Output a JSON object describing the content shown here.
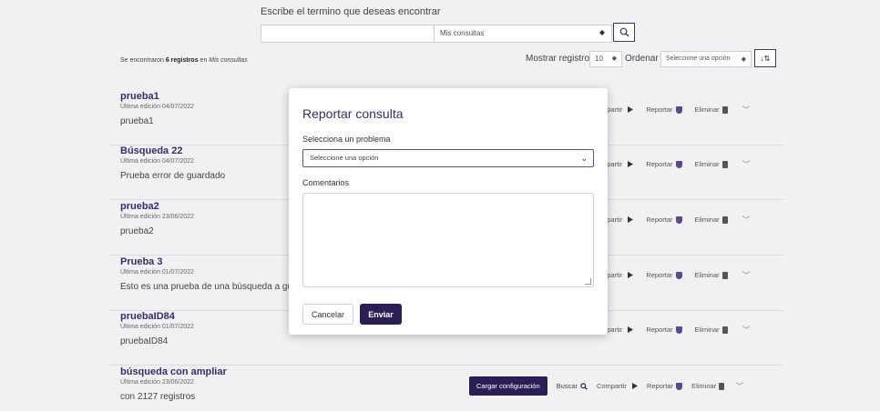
{
  "search": {
    "hint": "Escribe el termino que deseas encontrar",
    "input_value": "",
    "select_value": "Mis consultas"
  },
  "summary": {
    "prefix": "Se encontraron ",
    "count": "6 registros",
    "middle": " en ",
    "scope": "Mis consultas"
  },
  "controls": {
    "records_label": "Mostrar registros",
    "records_value": "10",
    "order_label": "Ordenar",
    "order_value": "Seleccione una opción",
    "sort_symbol": "↓⇅"
  },
  "rows": [
    {
      "title": "prueba1",
      "date": "Última edición 04/07/2022",
      "desc": "prueba1"
    },
    {
      "title": "Búsqueda 22",
      "date": "Última edición 04/07/2022",
      "desc": "Prueba error de guardado"
    },
    {
      "title": "prueba2",
      "date": "Última edición 23/06/2022",
      "desc": "prueba2"
    },
    {
      "title": "Prueba 3",
      "date": "Última edición 01/07/2022",
      "desc": "Esto es una prueba de una búsqueda a guarda"
    },
    {
      "title": "pruebaID84",
      "date": "Última edición 01/07/2022",
      "desc": "pruebaID84"
    },
    {
      "title": "búsqueda con ampliar",
      "date": "Última edición 23/06/2022",
      "desc": "con 2127 registros"
    }
  ],
  "row_actions": {
    "share_partial": "mpartir",
    "share": "Compartir",
    "report": "Reportar",
    "delete": "Eliminar",
    "load": "Cargar configuración",
    "search": "Buscar"
  },
  "modal": {
    "title": "Reportar consulta",
    "problem_label": "Selecciona un problema",
    "problem_value": "Seleccione una opción",
    "comments_label": "Comentarios",
    "comments_value": "",
    "cancel": "Cancelar",
    "send": "Enviar"
  },
  "colors": {
    "brand": "#2b1e55",
    "title": "#3a2c6b",
    "background": "#f1f1f3"
  }
}
